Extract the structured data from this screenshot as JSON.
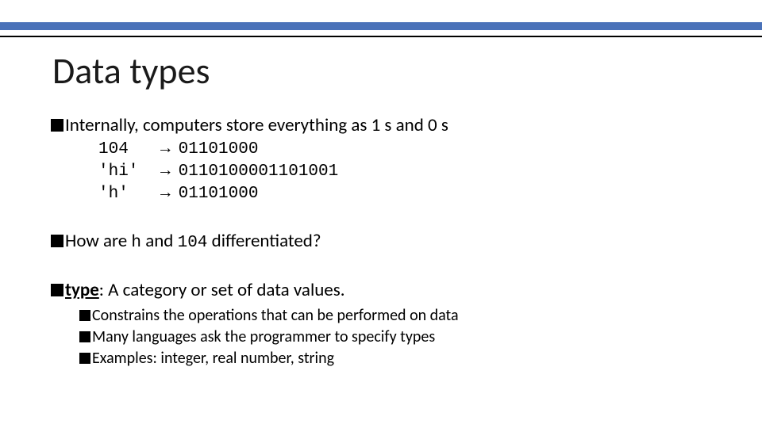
{
  "title": "Data types",
  "bullets": {
    "b1": "Internally, computers store everything as 1 s and 0 s",
    "b2_pre": "How are ",
    "b2_code1": "h",
    "b2_mid": " and ",
    "b2_code2": "104",
    "b2_post": " differentiated?",
    "b3_term": "type",
    "b3_rest": ": A category or set of data values."
  },
  "binary_rows": [
    {
      "value": "104",
      "arrow": "→",
      "bits": "01101000"
    },
    {
      "value": "'hi'",
      "arrow": "→",
      "bits": "0110100001101001"
    },
    {
      "value": "'h'",
      "arrow": "→",
      "bits": "01101000"
    }
  ],
  "sub_bullets": {
    "s1": "Constrains the operations that can be performed on data",
    "s2": "Many languages ask the programmer to specify types",
    "s3": "Examples: integer, real number, string"
  }
}
